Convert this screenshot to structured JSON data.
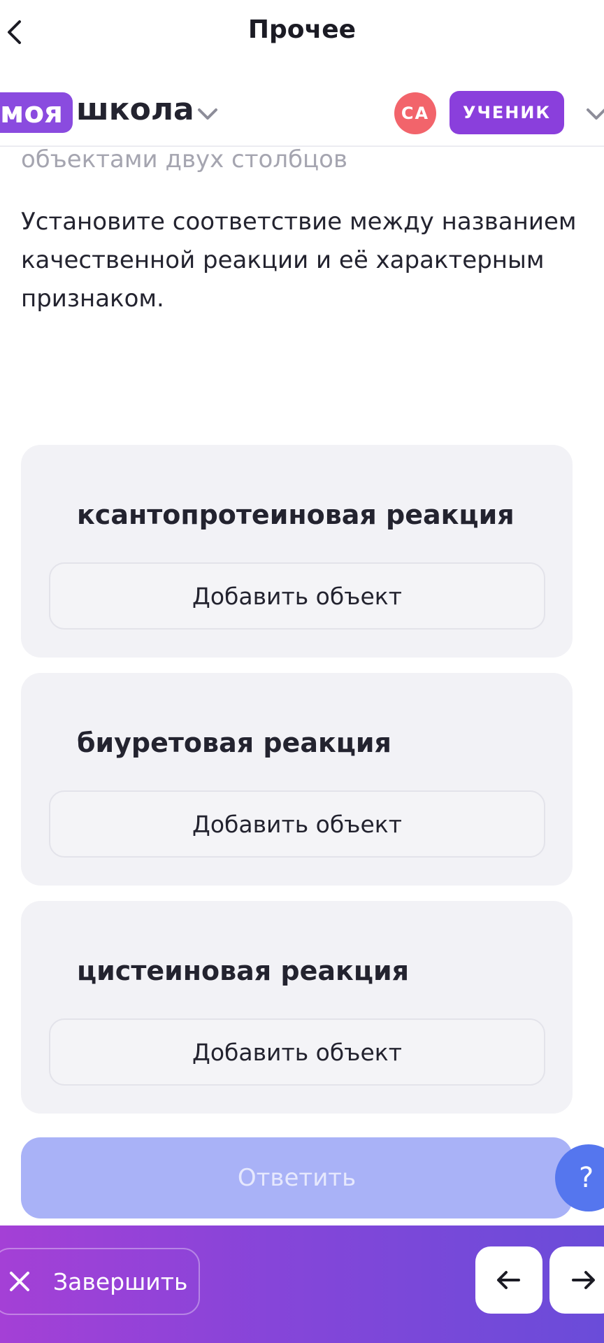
{
  "header": {
    "title": "Прочее"
  },
  "brand": {
    "logo_part1": "моя",
    "logo_part2": "школа",
    "avatar_initials": "СА",
    "role": "УЧЕНИК"
  },
  "task": {
    "cut_text": "объектами двух столбцов",
    "instruction": "Установите соответствие между названием качественной реакции и её характерным признаком."
  },
  "cards": [
    {
      "title": "ксантопротеиновая реакция",
      "add_label": "Добавить объект"
    },
    {
      "title": "биуретовая реакция",
      "add_label": "Добавить объект"
    },
    {
      "title": "цистеиновая реакция",
      "add_label": "Добавить объект"
    }
  ],
  "answer_label": "Ответить",
  "help_label": "?",
  "bottom": {
    "finish_label": "Завершить"
  },
  "colors": {
    "accent": "#8a3fdc",
    "avatar": "#f2646b",
    "answer_disabled": "#a9b2f7",
    "help": "#5576ee"
  }
}
